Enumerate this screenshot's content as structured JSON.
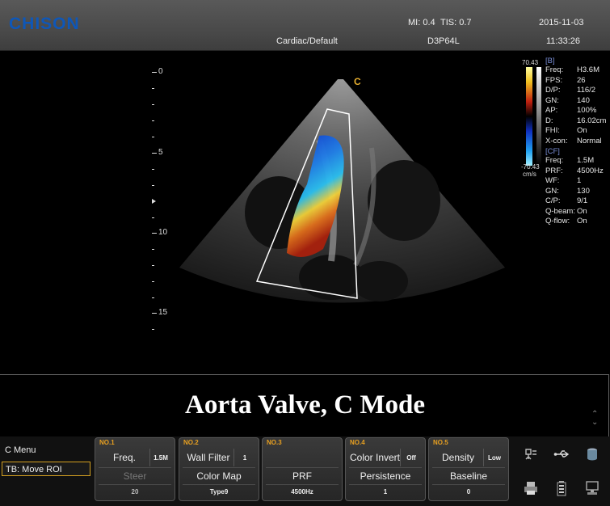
{
  "header": {
    "brand": "CHISON",
    "mi": "MI:  0.4",
    "tis": "TIS:  0.7",
    "date": "2015-11-03",
    "preset": "Cardiac/Default",
    "probe": "D3P64L",
    "time": "11:33:26"
  },
  "image": {
    "marker": "C",
    "depth_ticks": [
      "0",
      "5",
      "10",
      "15"
    ],
    "color_scale": {
      "top": "70.43",
      "bottom": "-70.43",
      "unit": "cm/s"
    }
  },
  "params": {
    "b_header": "[B]",
    "b": [
      {
        "k": "Freq:",
        "v": "H3.6M"
      },
      {
        "k": "FPS:",
        "v": "26"
      },
      {
        "k": "D/P:",
        "v": "116/2"
      },
      {
        "k": "GN:",
        "v": "140"
      },
      {
        "k": "AP:",
        "v": "100%"
      },
      {
        "k": "D:",
        "v": "16.02cm"
      },
      {
        "k": "FHI:",
        "v": "On"
      },
      {
        "k": "X-con:",
        "v": "Normal"
      }
    ],
    "cf_header": "[CF]",
    "cf": [
      {
        "k": "Freq:",
        "v": "1.5M"
      },
      {
        "k": "PRF:",
        "v": "4500Hz"
      },
      {
        "k": "WF:",
        "v": "1"
      },
      {
        "k": "GN:",
        "v": "130"
      },
      {
        "k": "C/P:",
        "v": "9/1"
      },
      {
        "k": "Q-beam:",
        "v": "On"
      },
      {
        "k": "Q-flow:",
        "v": "On"
      }
    ]
  },
  "caption": "Aorta Valve, C Mode",
  "menu": {
    "title": "C Menu",
    "tb": "TB: Move ROI"
  },
  "panels": [
    {
      "no": "NO.1",
      "top_label": "Freq.",
      "top_val": "1.5M",
      "mid": "Steer",
      "bottom": "20"
    },
    {
      "no": "NO.2",
      "top_label": "Wall Filter",
      "top_val": "1",
      "mid": "Color Map",
      "bottom": "Type9"
    },
    {
      "no": "NO.3",
      "top_label": "",
      "top_val": "",
      "mid": "PRF",
      "bottom": "4500Hz"
    },
    {
      "no": "NO.4",
      "top_label": "Color Invert",
      "top_val": "Off",
      "mid": "Persistence",
      "bottom": "1"
    },
    {
      "no": "NO.5",
      "top_label": "Density",
      "top_val": "Low",
      "mid": "Baseline",
      "bottom": "0"
    }
  ],
  "icons": [
    "probe-icon",
    "usb-icon",
    "storage-icon",
    "printer-icon",
    "battery-icon",
    "monitor-icon"
  ]
}
